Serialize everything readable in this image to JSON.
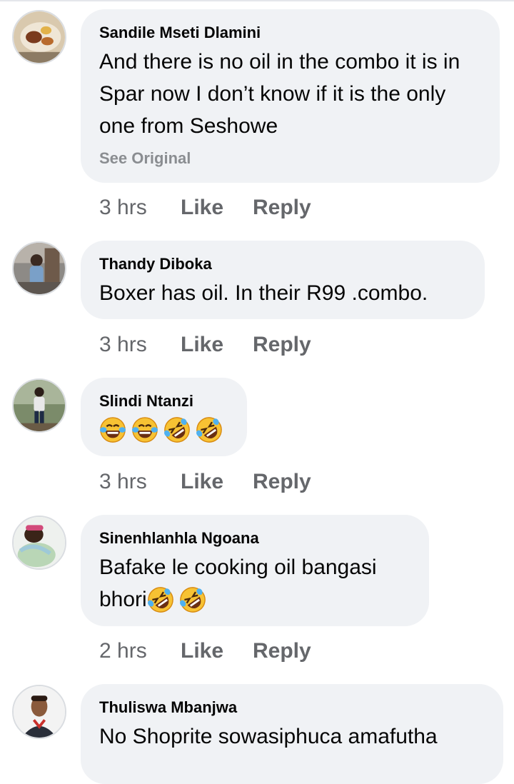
{
  "comments": [
    {
      "author": "Sandile Mseti Dlamini",
      "text": "And there is no oil in the combo it is in Spar now I don’t know if it is the only one from Seshowe",
      "see_original": "See Original",
      "time": "3 hrs",
      "like": "Like",
      "reply": "Reply"
    },
    {
      "author": "Thandy Diboka",
      "text": "Boxer has oil. In their R99 .combo.",
      "time": "3 hrs",
      "like": "Like",
      "reply": "Reply"
    },
    {
      "author": "Slindi Ntanzi",
      "emojis": [
        "face-with-tears-of-joy",
        "face-with-tears-of-joy",
        "rolling-on-floor-laughing",
        "rolling-on-floor-laughing"
      ],
      "time": "3 hrs",
      "like": "Like",
      "reply": "Reply"
    },
    {
      "author": "Sinenhlanhla Ngoana",
      "text_line1": "Bafake le cooking oil bangasi",
      "text_line2": "bhori",
      "emojis": [
        "rolling-on-floor-laughing",
        "rolling-on-floor-laughing"
      ],
      "time": "2 hrs",
      "like": "Like",
      "reply": "Reply"
    },
    {
      "author": "Thuliswa Mbanjwa",
      "text": "No Shoprite sowasiphuca amafutha"
    }
  ],
  "colors": {
    "bubble": "#f0f2f5",
    "text": "#050505",
    "meta": "#65676b",
    "see_original": "#8a8d91"
  }
}
